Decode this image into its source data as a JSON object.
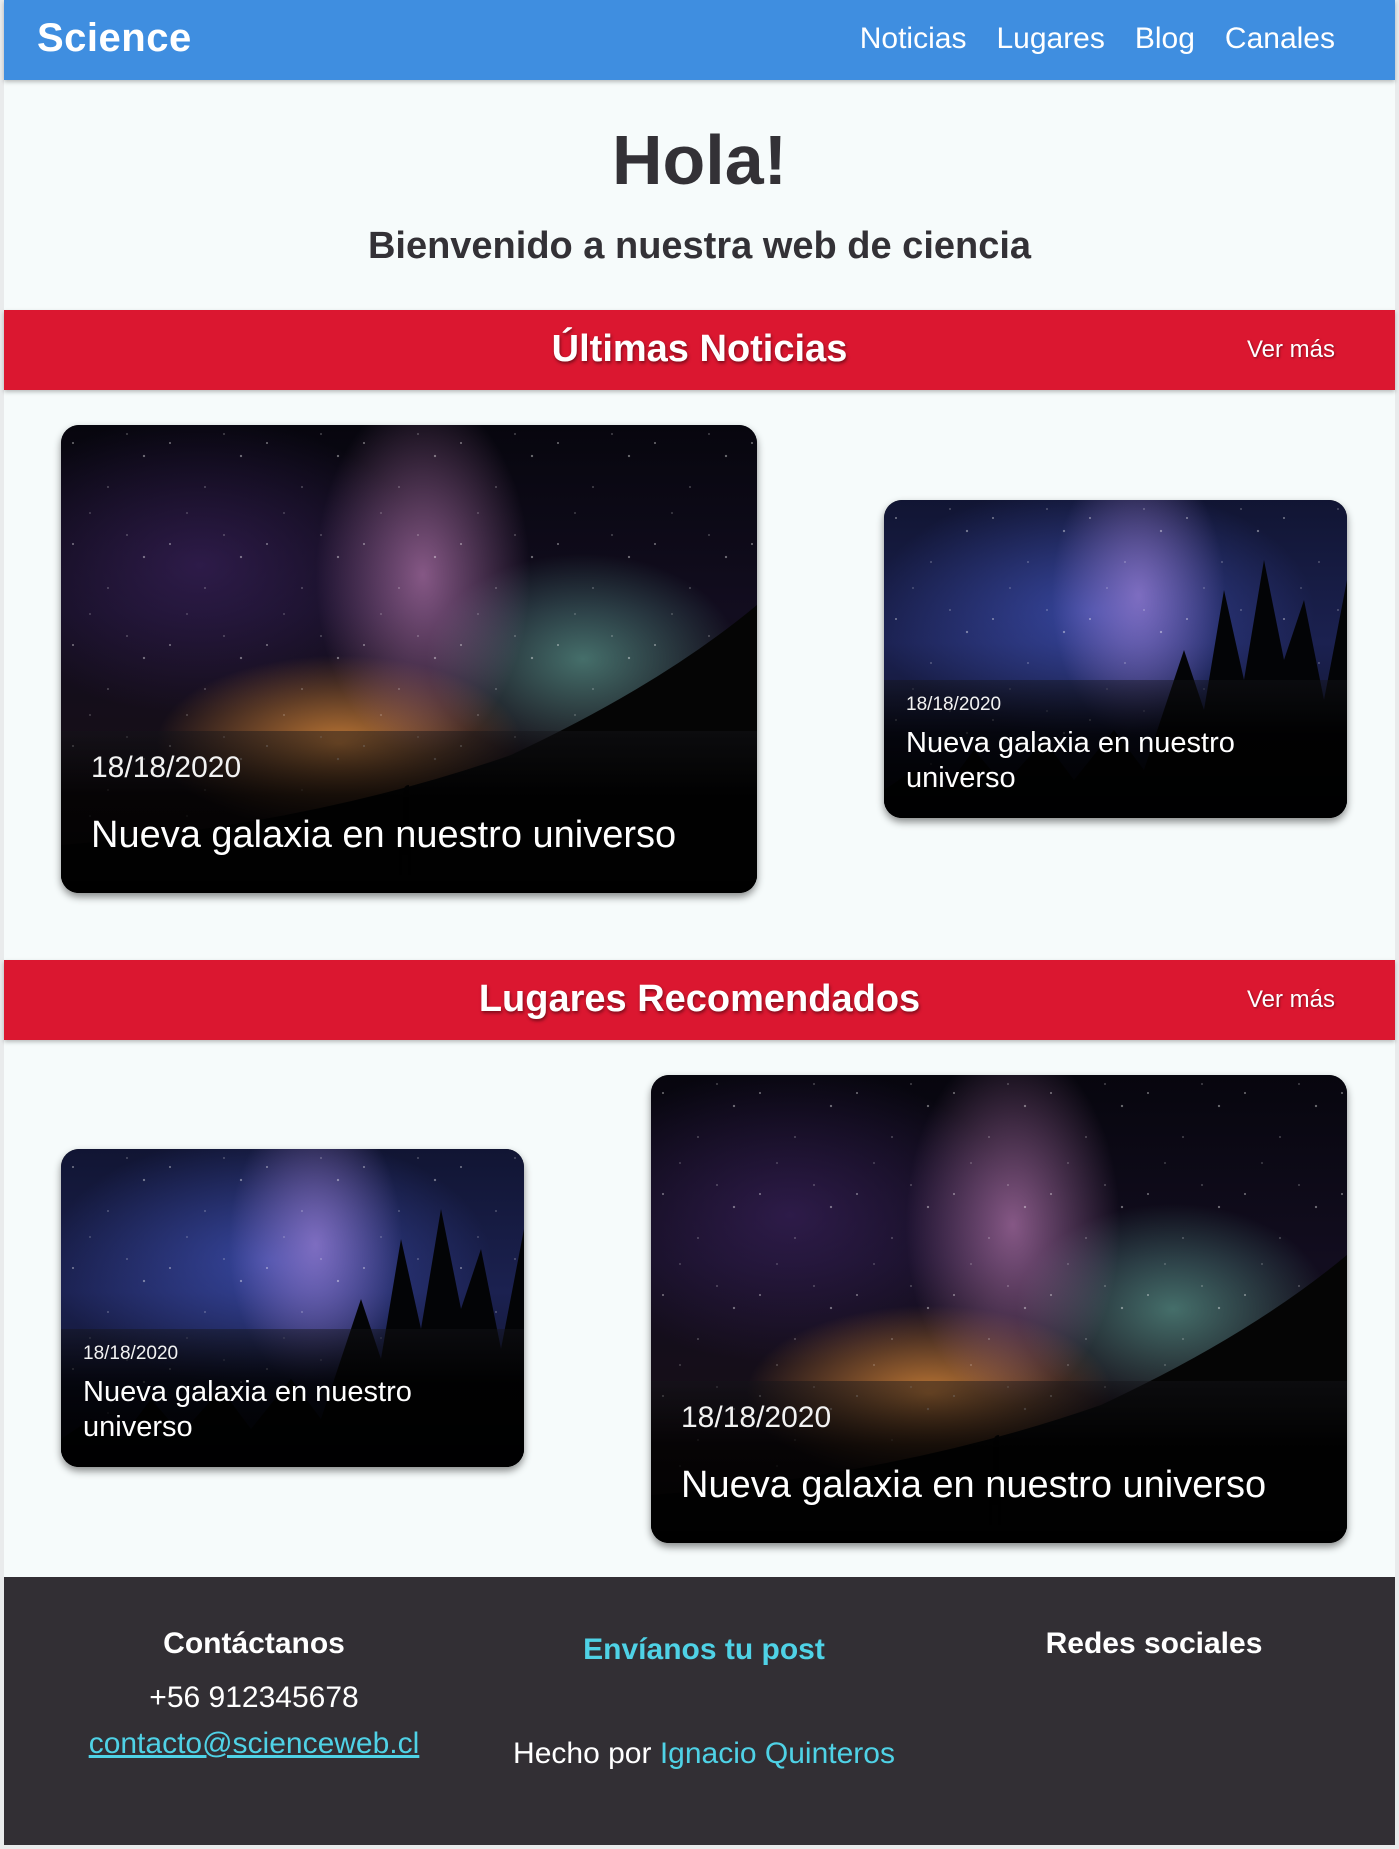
{
  "navbar": {
    "brand": "Science",
    "links": [
      "Noticias",
      "Lugares",
      "Blog",
      "Canales"
    ]
  },
  "hero": {
    "title": "Hola!",
    "subtitle": "Bienvenido a nuestra web de ciencia"
  },
  "news_section": {
    "title": "Últimas Noticias",
    "more": "Ver más",
    "cards": [
      {
        "date": "18/18/2020",
        "title": "Nueva galaxia en nuestro universo"
      },
      {
        "date": "18/18/2020",
        "title": "Nueva galaxia en nuestro universo"
      }
    ]
  },
  "places_section": {
    "title": "Lugares Recomendados",
    "more": "Ver más",
    "cards": [
      {
        "date": "18/18/2020",
        "title": "Nueva galaxia en nuestro universo"
      },
      {
        "date": "18/18/2020",
        "title": "Nueva galaxia en nuestro universo"
      }
    ]
  },
  "footer": {
    "contact_heading": "Contáctanos",
    "phone": "+56 912345678",
    "email": "contacto@scienceweb.cl",
    "post_heading": "Envíanos tu post",
    "made_by_prefix": "Hecho por",
    "made_by_name": "Ignacio Quinteros",
    "social_heading": "Redes sociales"
  },
  "colors": {
    "navbar": "#3f8ee0",
    "band": "#db1730",
    "footer": "#322f34",
    "accent": "#4fd2e6"
  }
}
